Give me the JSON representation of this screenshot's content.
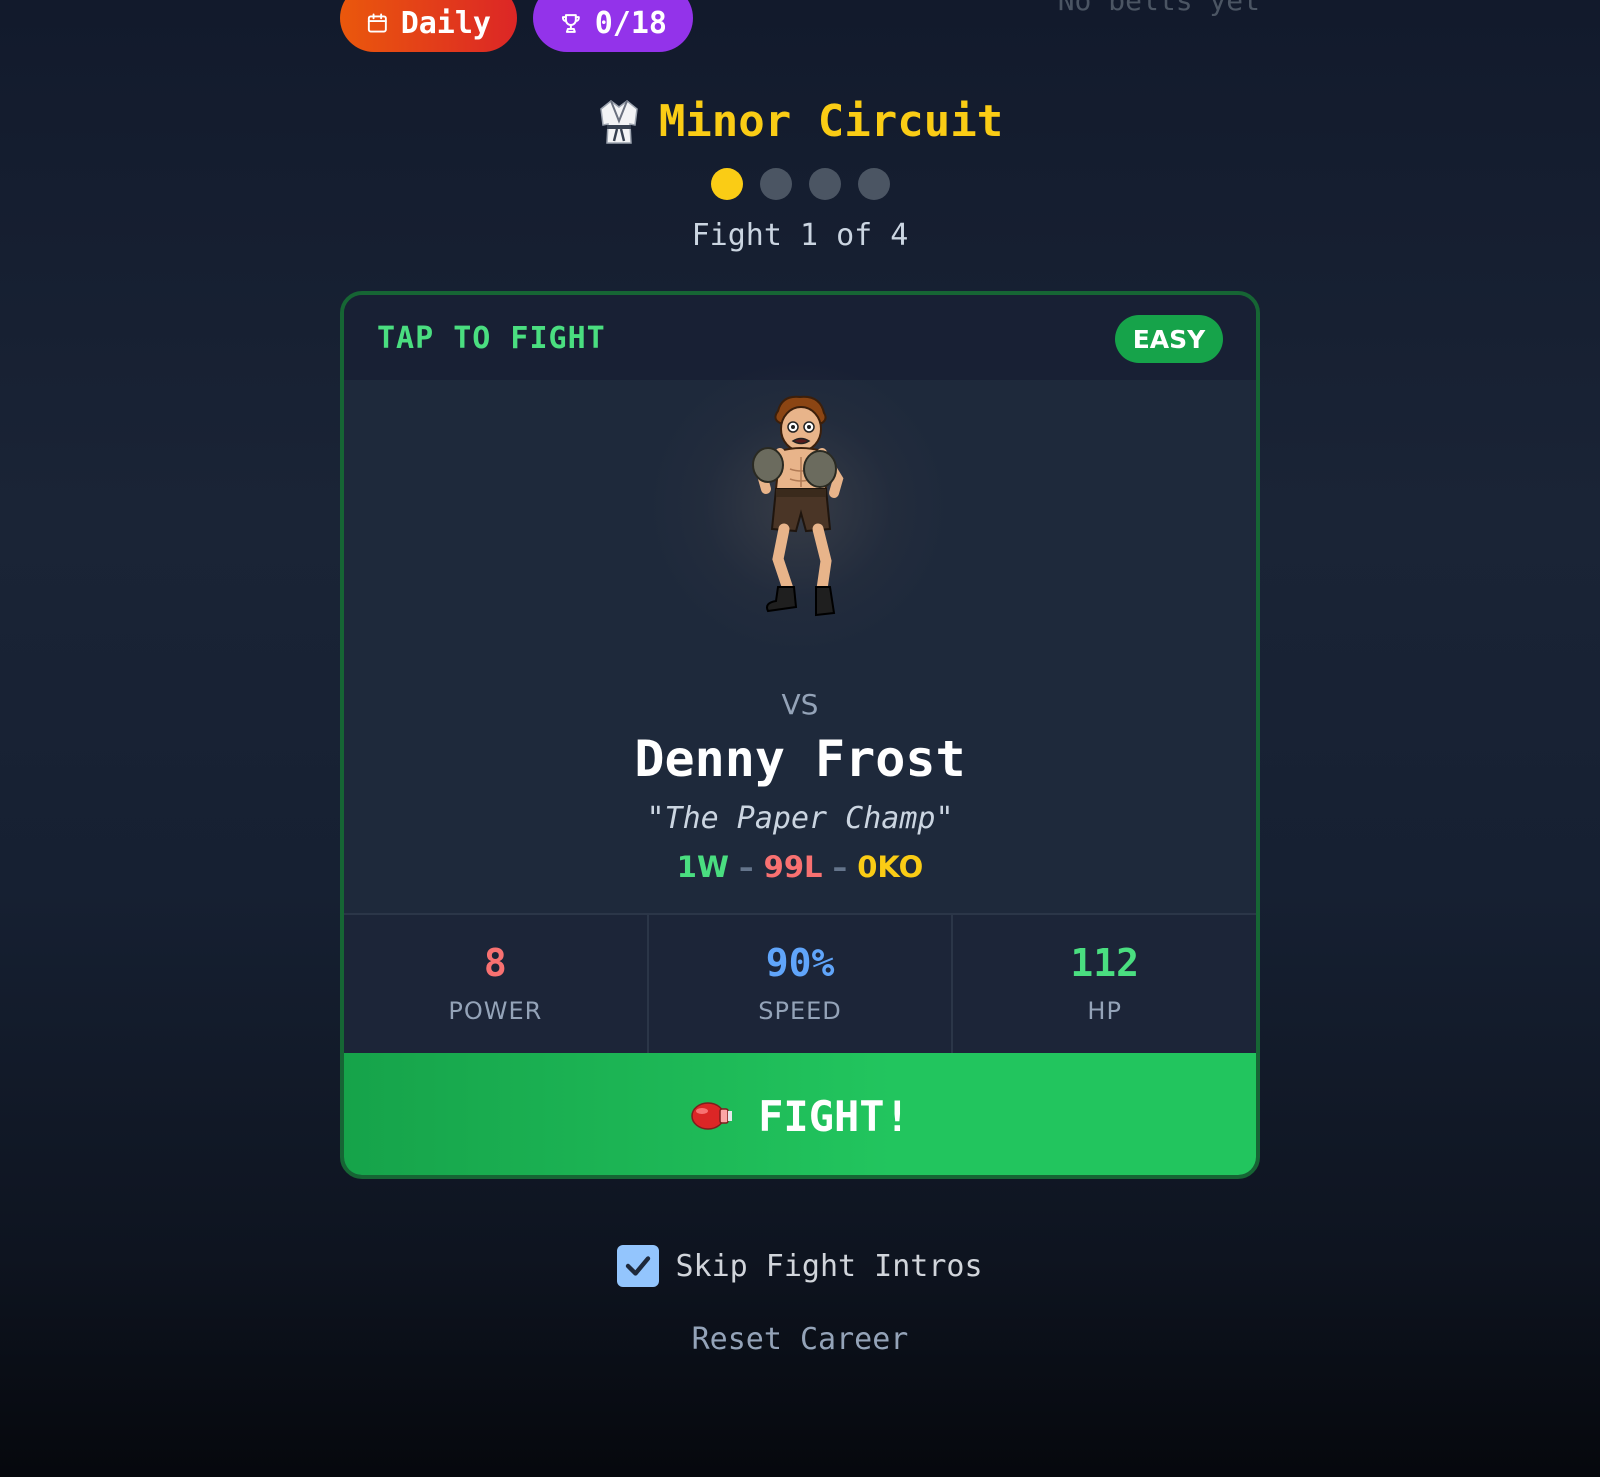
{
  "top_bar": {
    "daily_label": "Daily",
    "trophy_count": "0/18",
    "belts_status": "No belts yet"
  },
  "circuit": {
    "title": "Minor Circuit",
    "icon": "martial-arts-uniform-icon",
    "progress_fights_total": 4,
    "progress_current": 1,
    "fight_count_text": "Fight 1 of 4"
  },
  "card": {
    "tap_label": "TAP TO FIGHT",
    "difficulty": "EASY",
    "vs_label": "VS",
    "fighter_name": "Denny Frost",
    "nickname": "\"The Paper Champ\"",
    "record": {
      "wins": "1W",
      "losses": "99L",
      "kos": "0KO",
      "separator": "–"
    },
    "stats": [
      {
        "value": "8",
        "label": "POWER"
      },
      {
        "value": "90%",
        "label": "SPEED"
      },
      {
        "value": "112",
        "label": "HP"
      }
    ],
    "fight_button": "FIGHT!"
  },
  "settings": {
    "skip_intros_label": "Skip Fight Intros",
    "skip_intros_checked": true,
    "reset_label": "Reset Career"
  },
  "colors": {
    "accent_gold": "#facc15",
    "accent_green": "#22c55e",
    "daily_orange": "#ea580c",
    "trophy_purple": "#9333ea"
  }
}
